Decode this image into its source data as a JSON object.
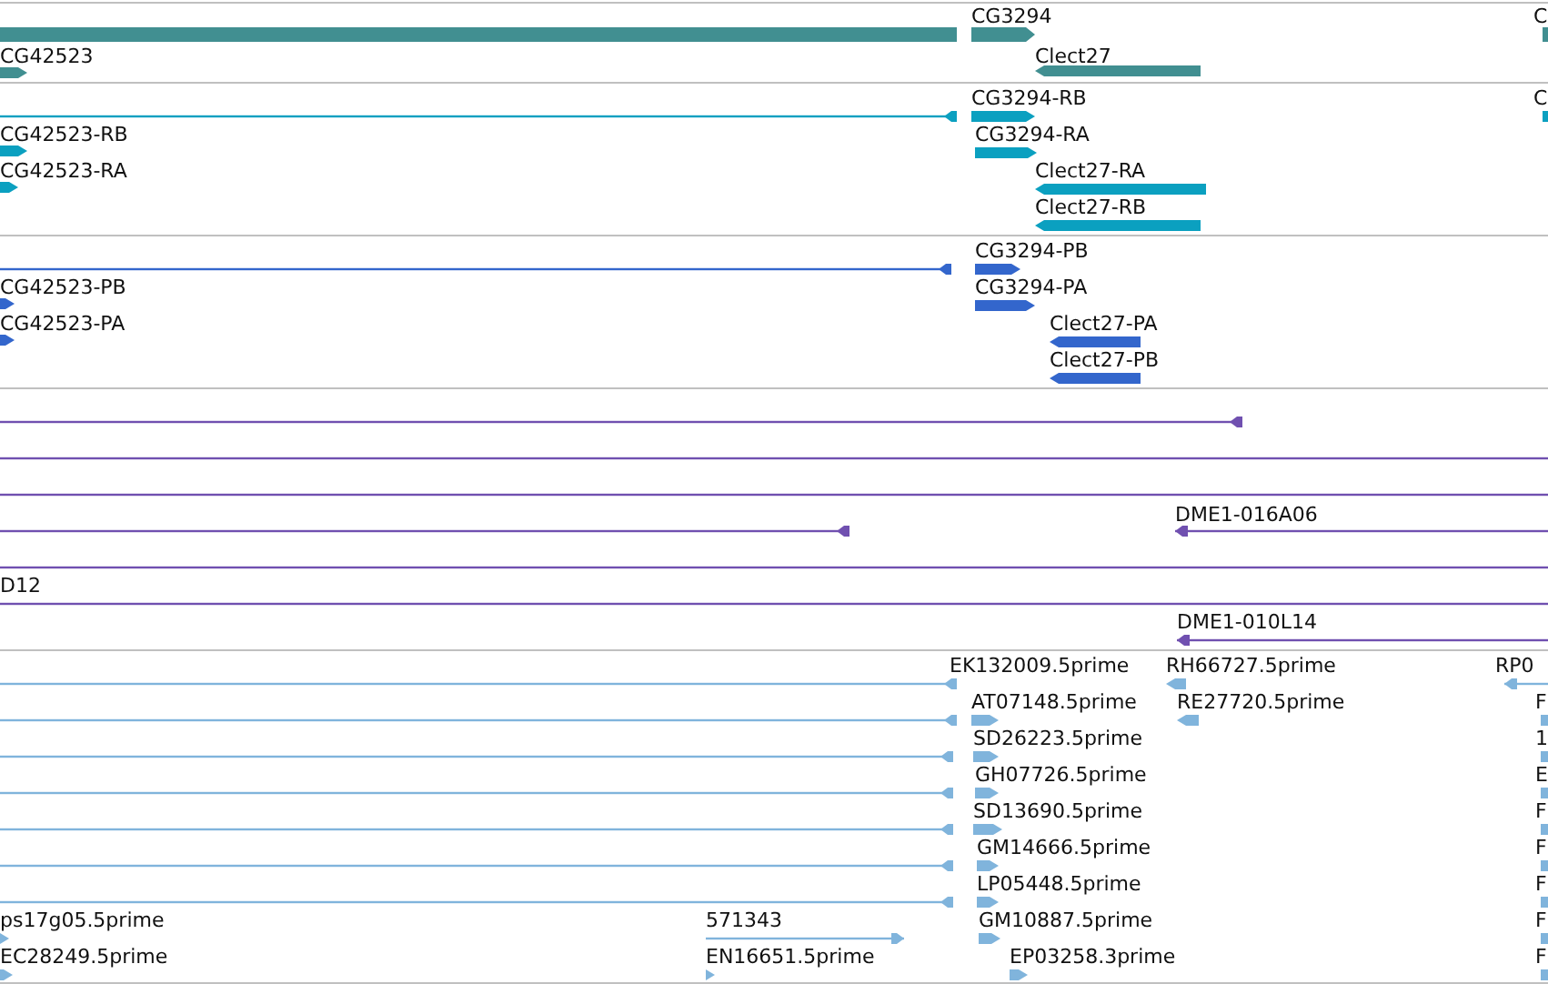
{
  "tracks": [
    {
      "color": "#418f91",
      "features": [
        {
          "kind": "bar"
        },
        {
          "label": "CG42523",
          "kind": "bar",
          "reverse": false
        },
        {
          "label": "CG3294",
          "kind": "bar",
          "reverse": false
        },
        {
          "label": "Clect27",
          "kind": "bar",
          "reverse": true
        },
        {
          "label": "C",
          "kind": "bar"
        }
      ]
    },
    {
      "color": "#0ba0c0",
      "features": [
        {
          "kind": "line",
          "reverse": true
        },
        {
          "label": "CG42523-RB",
          "kind": "bar",
          "reverse": false
        },
        {
          "label": "CG42523-RA",
          "kind": "bar",
          "reverse": false
        },
        {
          "label": "CG3294-RB",
          "kind": "bar",
          "reverse": false
        },
        {
          "label": "CG3294-RA",
          "kind": "bar",
          "reverse": false
        },
        {
          "label": "Clect27-RA",
          "kind": "bar",
          "reverse": true
        },
        {
          "label": "Clect27-RB",
          "kind": "bar",
          "reverse": true
        },
        {
          "label": "C",
          "kind": "bar"
        }
      ]
    },
    {
      "color": "#3366cc",
      "features": [
        {
          "kind": "line",
          "reverse": true
        },
        {
          "label": "CG42523-PB",
          "kind": "bar",
          "reverse": false
        },
        {
          "label": "CG42523-PA",
          "kind": "bar",
          "reverse": false
        },
        {
          "label": "CG3294-PB",
          "kind": "bar",
          "reverse": false
        },
        {
          "label": "CG3294-PA",
          "kind": "bar",
          "reverse": false
        },
        {
          "label": "Clect27-PA",
          "kind": "bar",
          "reverse": true
        },
        {
          "label": "Clect27-PB",
          "kind": "bar",
          "reverse": true
        }
      ]
    },
    {
      "color": "#7050b0",
      "features": [
        {
          "kind": "line",
          "reverse": true
        },
        {
          "kind": "line"
        },
        {
          "kind": "line"
        },
        {
          "kind": "line",
          "reverse": true
        },
        {
          "label": "DME1-016A06",
          "kind": "line",
          "reverse": true
        },
        {
          "kind": "line"
        },
        {
          "label": "D12",
          "kind": "line"
        },
        {
          "label": "DME1-010L14",
          "kind": "line",
          "reverse": true
        }
      ]
    },
    {
      "color": "#80b4dc",
      "features": [
        {
          "label": "EK132009.5prime",
          "kind": "line",
          "reverse": true
        },
        {
          "label": "RH66727.5prime",
          "kind": "bar",
          "reverse": true
        },
        {
          "label": "RP0",
          "kind": "line",
          "reverse": true
        },
        {
          "kind": "line",
          "reverse": true
        },
        {
          "label": "AT07148.5prime",
          "kind": "bar",
          "reverse": false
        },
        {
          "label": "RE27720.5prime",
          "kind": "bar",
          "reverse": true
        },
        {
          "label": "F",
          "kind": "bar"
        },
        {
          "kind": "line",
          "reverse": true
        },
        {
          "label": "SD26223.5prime",
          "kind": "bar",
          "reverse": false
        },
        {
          "label": "1",
          "kind": "bar"
        },
        {
          "kind": "line",
          "reverse": true
        },
        {
          "label": "GH07726.5prime",
          "kind": "bar",
          "reverse": false
        },
        {
          "label": "E",
          "kind": "bar"
        },
        {
          "kind": "line",
          "reverse": true
        },
        {
          "label": "SD13690.5prime",
          "kind": "bar",
          "reverse": false
        },
        {
          "label": "F",
          "kind": "bar"
        },
        {
          "kind": "line",
          "reverse": true
        },
        {
          "label": "GM14666.5prime",
          "kind": "bar",
          "reverse": false
        },
        {
          "label": "F",
          "kind": "bar"
        },
        {
          "kind": "line",
          "reverse": true
        },
        {
          "label": "LP05448.5prime",
          "kind": "bar",
          "reverse": false
        },
        {
          "label": "F",
          "kind": "bar"
        },
        {
          "label": "ps17g05.5prime",
          "kind": "bar",
          "reverse": false
        },
        {
          "label": "571343",
          "kind": "line",
          "reverse": false
        },
        {
          "label": "GM10887.5prime",
          "kind": "bar",
          "reverse": false
        },
        {
          "label": "F",
          "kind": "bar"
        },
        {
          "label": "EC28249.5prime",
          "kind": "bar",
          "reverse": false
        },
        {
          "label": "EN16651.5prime",
          "kind": "bar",
          "reverse": false
        },
        {
          "label": "EP03258.3prime",
          "kind": "bar",
          "reverse": false
        },
        {
          "label": "F",
          "kind": "bar"
        }
      ]
    }
  ]
}
